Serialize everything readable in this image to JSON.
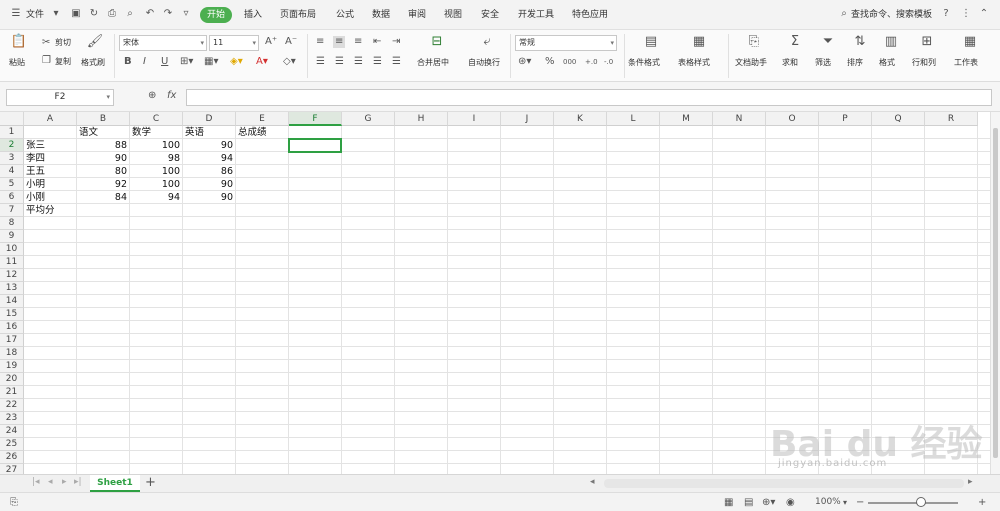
{
  "menu": {
    "file": "文件",
    "tabs": [
      "开始",
      "插入",
      "页面布局",
      "公式",
      "数据",
      "审阅",
      "视图",
      "安全",
      "开发工具",
      "特色应用"
    ],
    "search": "查找命令、搜索模板"
  },
  "ribbon": {
    "paste": "粘贴",
    "cut": "剪切",
    "copy": "复制",
    "format_painter": "格式刷",
    "font_name": "宋体",
    "font_size": "11",
    "merge_center": "合并居中",
    "wrap_text": "自动换行",
    "number_format": "常规",
    "conditional_format": "条件格式",
    "table_style": "表格样式",
    "doc_assistant": "文档助手",
    "sum": "求和",
    "filter": "筛选",
    "sort": "排序",
    "format": "格式",
    "row_col": "行和列",
    "worksheet": "工作表"
  },
  "formula_bar": {
    "name_box": "F2",
    "fx": "fx",
    "value": ""
  },
  "columns": [
    "A",
    "B",
    "C",
    "D",
    "E",
    "F",
    "G",
    "H",
    "I",
    "J",
    "K",
    "L",
    "M",
    "N",
    "O",
    "P",
    "Q",
    "R"
  ],
  "selected_column": "F",
  "rows": [
    "1",
    "2",
    "3",
    "4",
    "5",
    "6",
    "7",
    "8",
    "9",
    "10",
    "11",
    "12",
    "13",
    "14",
    "15",
    "16",
    "17",
    "18",
    "19",
    "20",
    "21",
    "22",
    "23",
    "24",
    "25",
    "26",
    "27"
  ],
  "selected_row": "2",
  "sheet": {
    "headers": [
      "语文",
      "数学",
      "英语",
      "总成绩"
    ],
    "students": [
      {
        "name": "张三",
        "scores": [
          "88",
          "100",
          "90"
        ]
      },
      {
        "name": "李四",
        "scores": [
          "90",
          "98",
          "94"
        ]
      },
      {
        "name": "王五",
        "scores": [
          "80",
          "100",
          "86"
        ]
      },
      {
        "name": "小明",
        "scores": [
          "92",
          "100",
          "90"
        ]
      },
      {
        "name": "小刚",
        "scores": [
          "84",
          "94",
          "90"
        ]
      }
    ],
    "average_label": "平均分"
  },
  "sheet_tabs": [
    "Sheet1"
  ],
  "status": {
    "zoom": "100%"
  },
  "watermark": {
    "brand": "Bai du 经验",
    "url": "jingyan.baidu.com"
  },
  "colors": {
    "accent": "#2ea043",
    "active_tab": "#4caf50"
  }
}
